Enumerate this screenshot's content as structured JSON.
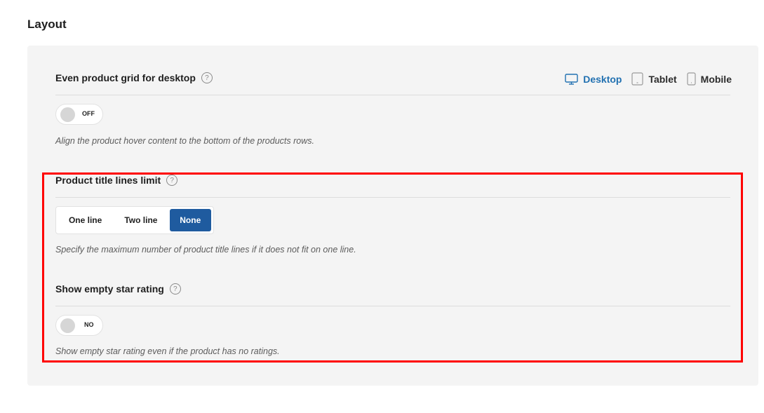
{
  "section": {
    "title": "Layout"
  },
  "devices": [
    {
      "label": "Desktop",
      "icon": "desktop-icon",
      "active": true
    },
    {
      "label": "Tablet",
      "icon": "tablet-icon",
      "active": false
    },
    {
      "label": "Mobile",
      "icon": "mobile-icon",
      "active": false
    }
  ],
  "fields": {
    "even_grid": {
      "label": "Even product grid for desktop",
      "help": "?",
      "toggle_state": "OFF",
      "description": "Align the product hover content to the bottom of the products rows."
    },
    "title_lines": {
      "label": "Product title lines limit",
      "help": "?",
      "options": [
        "One line",
        "Two line",
        "None"
      ],
      "selected": "None",
      "description": "Specify the maximum number of product title lines if it does not fit on one line."
    },
    "empty_star": {
      "label": "Show empty star rating",
      "help": "?",
      "toggle_state": "NO",
      "description": "Show empty star rating even if the product has no ratings."
    }
  },
  "colors": {
    "accent": "#2271b1",
    "selected_segment": "#1f5b9f",
    "highlight_box": "#ff0000",
    "panel_bg": "#f4f4f4"
  }
}
